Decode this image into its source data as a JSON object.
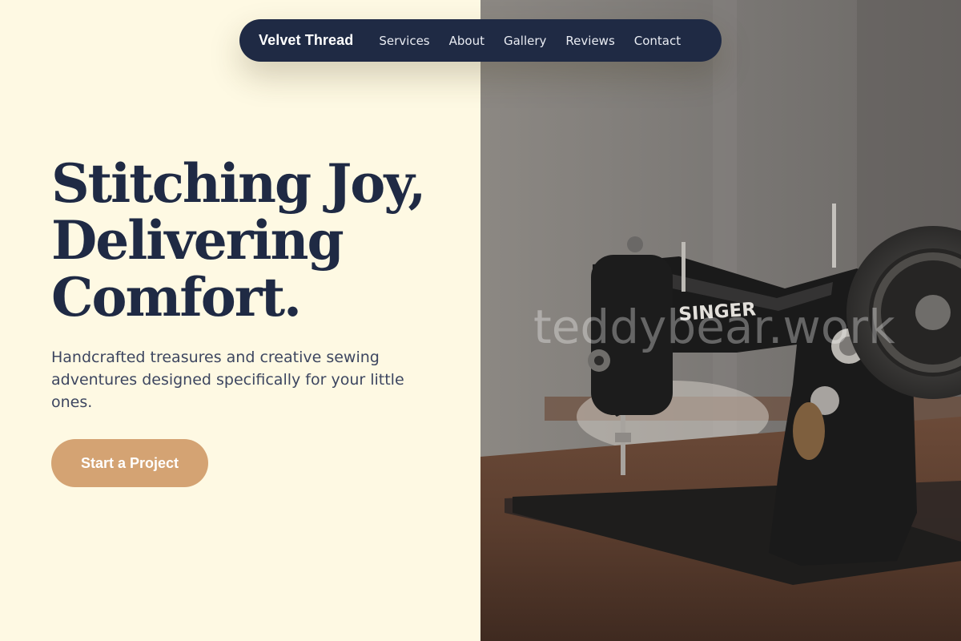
{
  "nav": {
    "brand": "Velvet Thread",
    "links": [
      "Services",
      "About",
      "Gallery",
      "Reviews",
      "Contact"
    ]
  },
  "hero": {
    "title_lines": [
      "Stitching Joy,",
      "Delivering",
      "Comfort."
    ],
    "subtitle": "Handcrafted treasures and creative sewing adventures designed specifically for your little ones.",
    "cta_label": "Start a Project"
  },
  "image": {
    "machine_brand": "SINGER",
    "watermark": "teddybear.work"
  },
  "colors": {
    "background": "#fef9e3",
    "nav_bg": "#1f2a44",
    "heading": "#1f2a44",
    "accent": "#d4a373"
  }
}
